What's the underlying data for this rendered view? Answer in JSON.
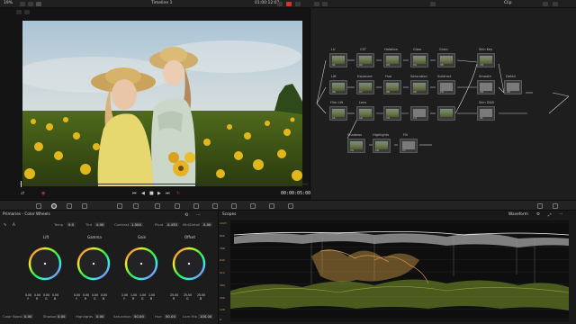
{
  "app": {
    "zoom": "19%",
    "timeline": "Timeline 1",
    "timecode": "01:00:12:07",
    "clip_mode": "Clip"
  },
  "viewer": {
    "timecode": "00:00:05:00"
  },
  "nodes": [
    {
      "num": "01",
      "label": "LU"
    },
    {
      "num": "02",
      "label": "CST"
    },
    {
      "num": "03",
      "label": "Halation"
    },
    {
      "num": "04",
      "label": "Glow"
    },
    {
      "num": "05",
      "label": "Grain"
    },
    {
      "num": "06",
      "label": "Lift"
    },
    {
      "num": "07",
      "label": "Exposure"
    },
    {
      "num": "08",
      "label": "Hue"
    },
    {
      "num": "09",
      "label": "Saturation"
    },
    {
      "num": "10",
      "label": "Subtract"
    },
    {
      "num": "11",
      "label": "Film Lift"
    },
    {
      "num": "12",
      "label": "Lens"
    },
    {
      "num": "13",
      "label": ""
    },
    {
      "num": "14",
      "label": ""
    },
    {
      "num": "15",
      "label": "Shadows"
    },
    {
      "num": "16",
      "label": "Highlights"
    },
    {
      "num": "17",
      "label": "Fill"
    },
    {
      "num": "18",
      "label": "Skin Key"
    },
    {
      "num": "19",
      "label": "Smooth"
    },
    {
      "num": "20",
      "label": "Detail"
    },
    {
      "num": "21",
      "label": "Skin D&B"
    }
  ],
  "primaries": {
    "title": "Primaries - Color Wheels",
    "temp_label": "Temp",
    "temp": "0.0",
    "tint_label": "Tint",
    "tint": "0.00",
    "contrast_label": "Contrast",
    "contrast": "1.000",
    "pivot_label": "Pivot",
    "pivot": "0.435",
    "middetail_label": "Mid/Detail",
    "middetail": "0.00",
    "wheels": [
      {
        "name": "Lift",
        "values": [
          "0.00",
          "0.00",
          "0.00",
          "0.00"
        ],
        "channels": [
          "Y",
          "R",
          "G",
          "B"
        ]
      },
      {
        "name": "Gamma",
        "values": [
          "0.00",
          "0.00",
          "0.00",
          "0.00"
        ],
        "channels": [
          "Y",
          "R",
          "G",
          "B"
        ]
      },
      {
        "name": "Gain",
        "values": [
          "1.00",
          "1.00",
          "1.00",
          "1.00"
        ],
        "channels": [
          "Y",
          "R",
          "G",
          "B"
        ]
      },
      {
        "name": "Offset",
        "values": [
          "25.00",
          "25.00",
          "25.00"
        ],
        "channels": [
          "R",
          "G",
          "B"
        ]
      }
    ],
    "color_boost_label": "Color Boost",
    "color_boost": "0.00",
    "shadow_label": "Shadow",
    "shadow": "0.00",
    "highlights_label": "Highlights",
    "highlights": "0.00",
    "saturation_label": "Saturation",
    "saturation": "50.00",
    "hue_label": "Hue",
    "hue": "50.00",
    "lummix_label": "Lum Mix",
    "lummix": "100.00"
  },
  "scopes": {
    "title": "Scopes",
    "mode": "Waveform",
    "scale": [
      "1023",
      "896",
      "768",
      "640",
      "512",
      "384",
      "256",
      "128",
      "0"
    ]
  },
  "colors": {
    "accent_red": "#d2352c",
    "waveform_white": "#e8e8e8",
    "waveform_yellow": "#d4b34a",
    "waveform_green": "#7d9a2c"
  }
}
